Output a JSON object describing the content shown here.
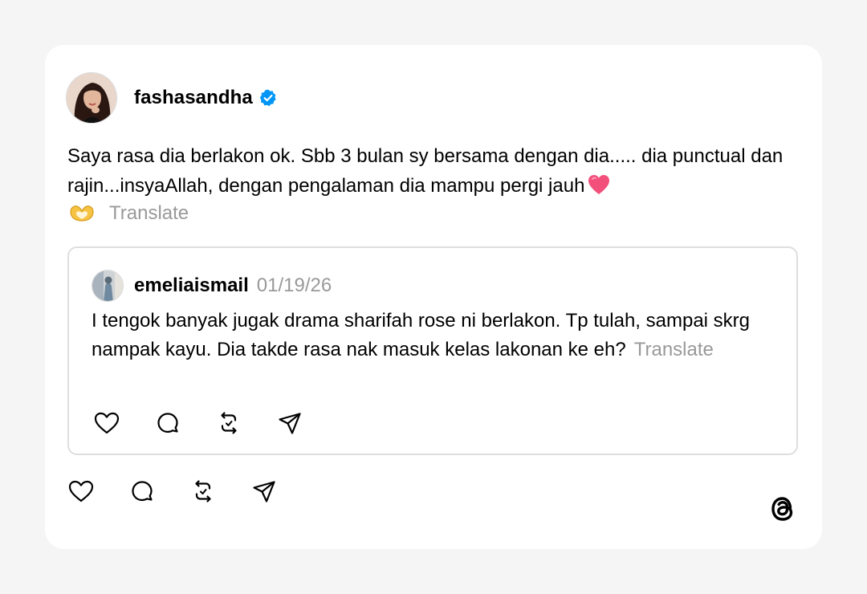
{
  "post": {
    "username": "fashasandha",
    "verified": true,
    "text": "Saya rasa dia berlakon ok. Sbb 3 bulan sy bersama dengan dia..... dia punctual dan rajin...insyaAllah, dengan pengalaman dia mampu pergi jauh",
    "emoji": "pink-heart",
    "translate_label": "Translate"
  },
  "quoted_post": {
    "username": "emeliaismail",
    "date": "01/19/26",
    "text": "I tengok banyak jugak drama sharifah rose ni berlakon. Tp tulah, sampai skrg nampak kayu. Dia takde rasa nak masuk kelas lakonan ke eh?",
    "translate_label": "Translate"
  },
  "icons": {
    "like": "heart-outline-icon",
    "reply": "comment-bubble-icon",
    "repost": "repost-arrows-icon",
    "share": "send-paper-plane-icon",
    "brand": "threads-logo-icon"
  },
  "colors": {
    "verified_badge": "#0095f6",
    "muted_text": "#999999",
    "heart_emoji": "#f2507b"
  }
}
